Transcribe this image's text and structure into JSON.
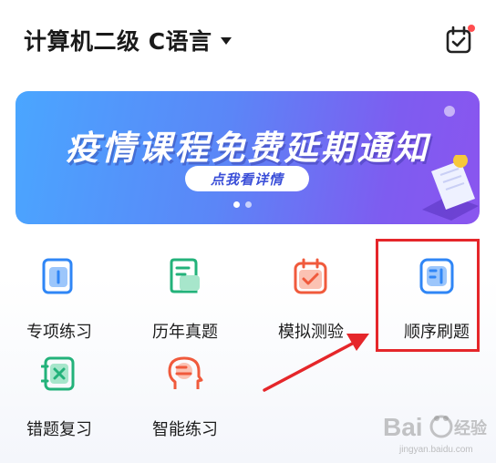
{
  "header": {
    "title": "计算机二级 C语言",
    "calendar_icon": "calendar-check-icon",
    "badge_color": "#ff4d4f"
  },
  "banner": {
    "title": "疫情课程免费延期通知",
    "cta": "点我看详情",
    "slide_count": 2,
    "active_slide": 1
  },
  "menu": [
    {
      "label": "专项练习",
      "icon": "notebook-icon",
      "color": "#2f86f6"
    },
    {
      "label": "历年真题",
      "icon": "document-icon",
      "color": "#23b27a"
    },
    {
      "label": "模拟测验",
      "icon": "calendar-check-icon",
      "color": "#f05a3c"
    },
    {
      "label": "顺序刷题",
      "icon": "list-icon",
      "color": "#2f86f6"
    },
    {
      "label": "错题复习",
      "icon": "error-book-icon",
      "color": "#23b27a"
    },
    {
      "label": "智能练习",
      "icon": "ai-head-icon",
      "color": "#f05a3c"
    }
  ],
  "annotation": {
    "color": "#e5262a"
  },
  "watermark": {
    "text": "Bai 经验",
    "subtext": "jingyan.baidu.com"
  }
}
